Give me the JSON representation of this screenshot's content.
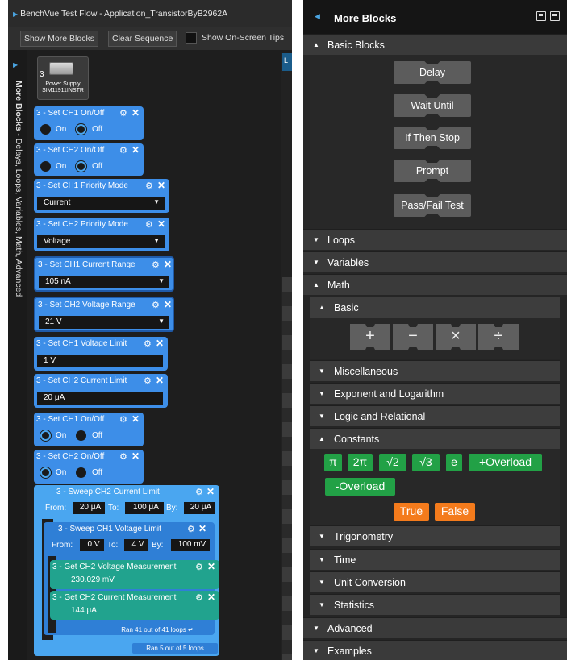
{
  "left": {
    "title": "BenchVue Test Flow - Application_TransistorByB2962A",
    "toolbar": {
      "show_more_blocks": "Show More Blocks",
      "clear_sequence": "Clear Sequence",
      "show_tips": "Show On-Screen Tips"
    },
    "strip_bold": "More Blocks",
    "strip_rest": " - Delays, Loops, Variables, Math, Advanced",
    "canvas_tab": "L",
    "device": {
      "count": "3",
      "name_line1": "Power Supply",
      "name_line2": "SIM11911INSTR"
    },
    "blocks": {
      "b1": {
        "title": "3 - Set CH1 On/Off",
        "on": "On",
        "off": "Off"
      },
      "b2": {
        "title": "3 - Set CH2 On/Off",
        "on": "On",
        "off": "Off"
      },
      "b3": {
        "title": "3 - Set CH1 Priority Mode",
        "value": "Current"
      },
      "b4": {
        "title": "3 - Set CH2 Priority Mode",
        "value": "Voltage"
      },
      "b5": {
        "title": "3 - Set CH1 Current Range",
        "value": "105 nA"
      },
      "b6": {
        "title": "3 - Set CH2 Voltage Range",
        "value": "21 V"
      },
      "b7": {
        "title": "3 - Set CH1 Voltage Limit",
        "value": "1 V"
      },
      "b8": {
        "title": "3 - Set CH2 Current Limit",
        "value": "20 μA"
      },
      "b9": {
        "title": "3 - Set CH1 On/Off",
        "on": "On",
        "off": "Off"
      },
      "b10": {
        "title": "3 - Set CH2 On/Off",
        "on": "On",
        "off": "Off"
      },
      "sweep_outer": {
        "title": "3 - Sweep CH2 Current Limit",
        "from_label": "From:",
        "from": "20 μA",
        "to_label": "To:",
        "to": "100 μA",
        "by_label": "By:",
        "by": "20 μA",
        "ran": "Ran 5 out of 5 loops"
      },
      "sweep_inner": {
        "title": "3 - Sweep CH1 Voltage Limit",
        "from_label": "From:",
        "from": "0 V",
        "to_label": "To:",
        "to": "4 V",
        "by_label": "By:",
        "by": "100 mV",
        "ran": "Ran 41 out of 41 loops"
      },
      "get_v": {
        "title": "3 - Get CH2 Voltage Measurement",
        "value": "230.029 mV"
      },
      "get_i": {
        "title": "3 - Get CH2 Current Measurement",
        "value": "144 μA"
      }
    }
  },
  "right": {
    "title": "More Blocks",
    "sections": {
      "basic_blocks": "Basic Blocks",
      "loops": "Loops",
      "variables": "Variables",
      "math": "Math",
      "advanced": "Advanced",
      "examples": "Examples"
    },
    "basic_blocks": [
      "Delay",
      "Wait Until",
      "If Then Stop",
      "Prompt",
      "Pass/Fail Test"
    ],
    "math_subs": {
      "basic": "Basic",
      "misc": "Miscellaneous",
      "explog": "Exponent and Logarithm",
      "logic": "Logic and Relational",
      "constants": "Constants",
      "trig": "Trigonometry",
      "time": "Time",
      "unit": "Unit Conversion",
      "stats": "Statistics"
    },
    "operators": [
      "+",
      "−",
      "×",
      "÷"
    ],
    "constants": [
      "π",
      "2π",
      "√2",
      "√3",
      "e",
      "+Overload",
      "-Overload"
    ],
    "booleans": [
      "True",
      "False"
    ]
  }
}
